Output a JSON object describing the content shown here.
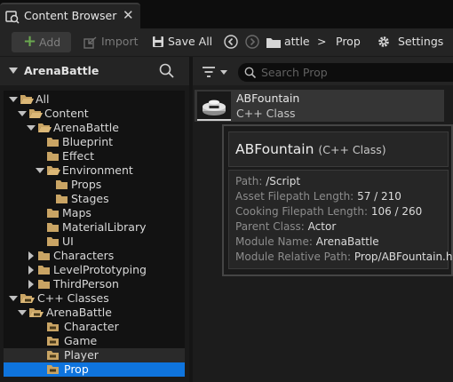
{
  "tab": {
    "title": "Content Browser",
    "close": "✕"
  },
  "toolbar": {
    "add_label": "Add",
    "import_label": "Import",
    "save_all_label": "Save All",
    "path_crumb_1": "attle",
    "path_sep": ">",
    "path_crumb_2": "Prop",
    "settings_label": "Settings"
  },
  "sources": {
    "title": "ArenaBattle",
    "tree": [
      {
        "label": "All"
      },
      {
        "label": "Content"
      },
      {
        "label": "ArenaBattle"
      },
      {
        "label": "Blueprint"
      },
      {
        "label": "Effect"
      },
      {
        "label": "Environment"
      },
      {
        "label": "Props"
      },
      {
        "label": "Stages"
      },
      {
        "label": "Maps"
      },
      {
        "label": "MaterialLibrary"
      },
      {
        "label": "UI"
      },
      {
        "label": "Characters"
      },
      {
        "label": "LevelPrototyping"
      },
      {
        "label": "ThirdPerson"
      },
      {
        "label": "C++ Classes"
      },
      {
        "label": "ArenaBattle"
      },
      {
        "label": "Character"
      },
      {
        "label": "Game"
      },
      {
        "label": "Player"
      },
      {
        "label": "Prop"
      }
    ]
  },
  "assets": {
    "search_placeholder": "Search Prop",
    "items": [
      {
        "name": "ABFountain",
        "type": "C++ Class"
      }
    ]
  },
  "tooltip": {
    "name": "ABFountain",
    "kind": "(C++ Class)",
    "rows": [
      {
        "key": "Path:",
        "value": "/Script"
      },
      {
        "key": "Asset Filepath Length:",
        "value": "57 / 210"
      },
      {
        "key": "Cooking Filepath Length:",
        "value": "106 / 260"
      },
      {
        "key": "Parent Class:",
        "value": "Actor"
      },
      {
        "key": "Module Name:",
        "value": "ArenaBattle"
      },
      {
        "key": "Module Relative Path:",
        "value": "Prop/ABFountain.h"
      }
    ]
  },
  "colors": {
    "selection": "#0f74dd",
    "add_plus": "#6aa84f",
    "folder": "#c9a464"
  },
  "icons": [
    "content-browser-icon",
    "plus-icon",
    "import-icon",
    "save-icon",
    "back-arrow-icon",
    "forward-arrow-icon",
    "folder-icon",
    "gear-icon",
    "search-icon",
    "filter-icon",
    "cpp-folder-icon"
  ]
}
